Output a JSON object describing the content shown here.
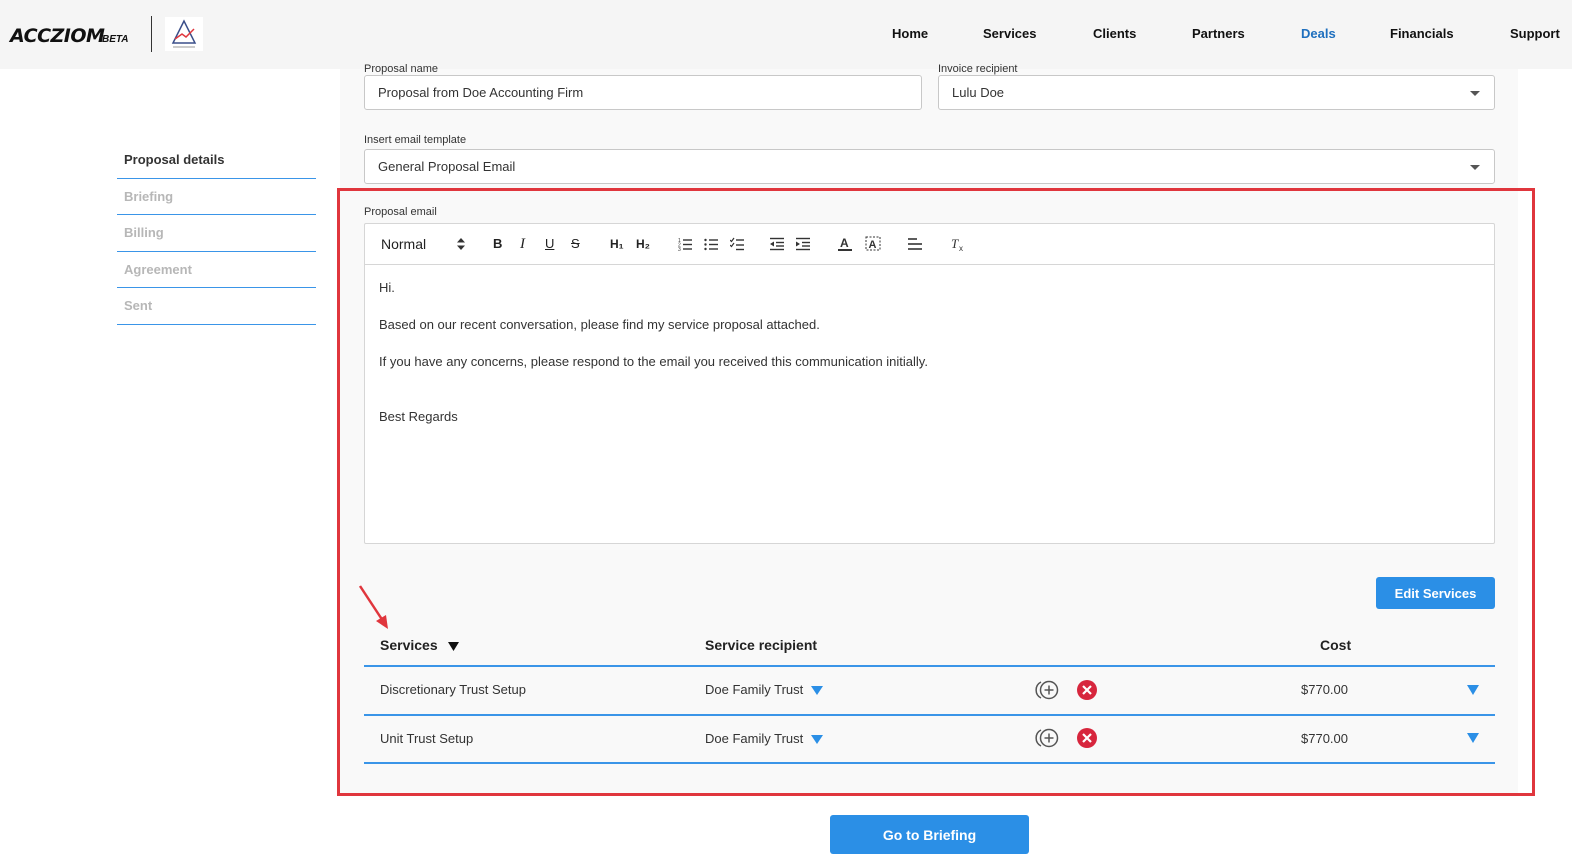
{
  "app": {
    "logo_text": "ACCZIOM",
    "logo_badge": "BETA"
  },
  "nav": {
    "items": [
      "Home",
      "Services",
      "Clients",
      "Partners",
      "Deals",
      "Financials",
      "Support"
    ],
    "active": "Deals"
  },
  "steps": {
    "items": [
      "Proposal details",
      "Briefing",
      "Billing",
      "Agreement",
      "Sent"
    ],
    "active": "Proposal details"
  },
  "form": {
    "proposal_name_label": "Proposal name",
    "proposal_name_value": "Proposal from Doe Accounting Firm",
    "invoice_recipient_label": "Invoice recipient",
    "invoice_recipient_value": "Lulu Doe",
    "email_template_label": "Insert email template",
    "email_template_value": "General Proposal Email",
    "proposal_email_label": "Proposal email"
  },
  "editor": {
    "format_select": "Normal",
    "toolbar_icons": [
      "bold-icon",
      "italic-icon",
      "underline-icon",
      "strikethrough-icon",
      "heading1-icon",
      "heading2-icon",
      "ordered-list-icon",
      "bullet-list-icon",
      "checklist-icon",
      "outdent-icon",
      "indent-icon",
      "text-color-icon",
      "background-color-icon",
      "align-icon",
      "clear-format-icon"
    ],
    "lines": [
      "Hi.",
      "Based on our recent conversation, please find my service proposal attached.",
      "If you have any concerns, please respond to the email you received this communication initially.",
      "Best Regards"
    ]
  },
  "services": {
    "edit_button": "Edit Services",
    "headers": {
      "services": "Services",
      "recipient": "Service recipient",
      "cost": "Cost"
    },
    "rows": [
      {
        "service": "Discretionary Trust Setup",
        "recipient": "Doe Family Trust",
        "cost": "$770.00"
      },
      {
        "service": "Unit Trust Setup",
        "recipient": "Doe Family Trust",
        "cost": "$770.00"
      }
    ]
  },
  "footer": {
    "next_button": "Go to Briefing"
  },
  "colors": {
    "accent": "#2b8fe6",
    "nav_active": "#1e6fbe",
    "highlight": "#e0363d",
    "delete": "#d7263d"
  }
}
